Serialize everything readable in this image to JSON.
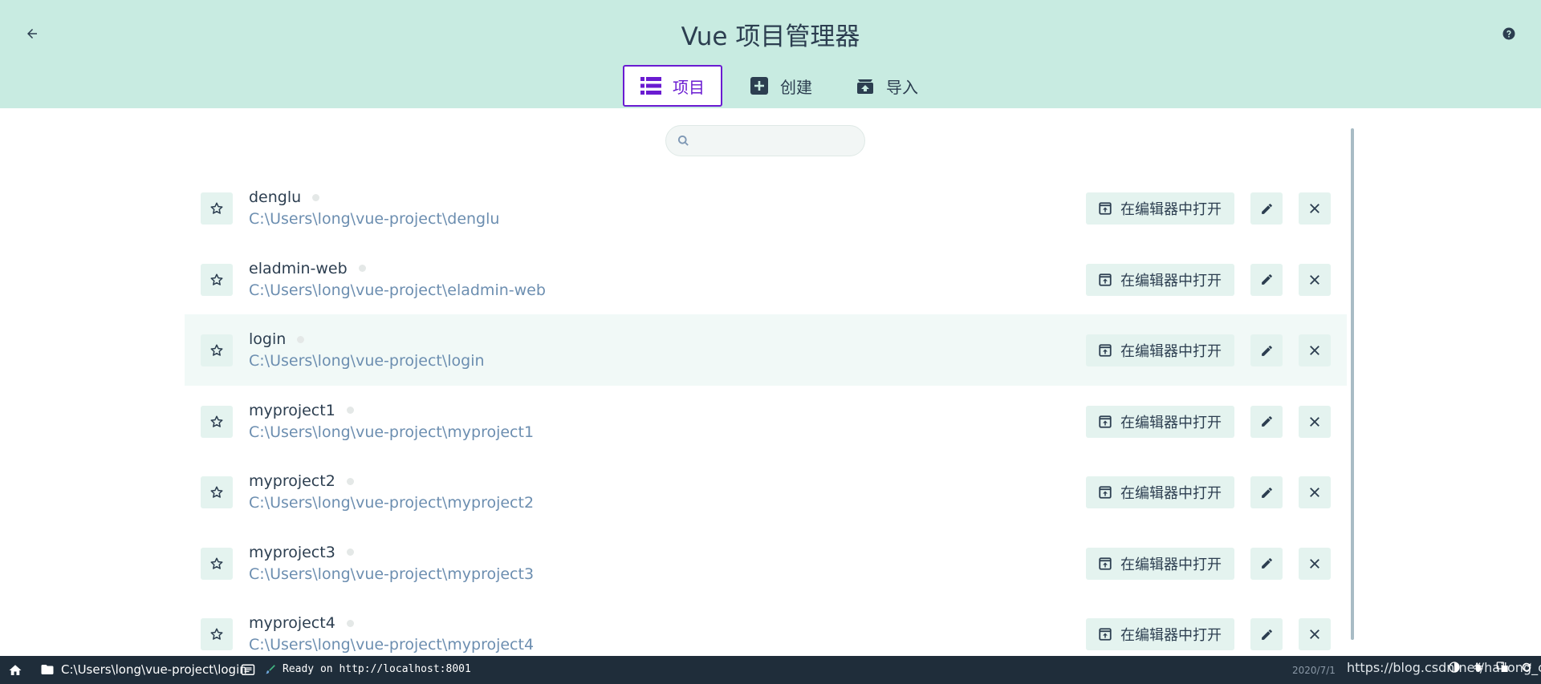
{
  "header": {
    "title": "Vue 项目管理器",
    "tabs": [
      {
        "label": "项目",
        "icon": "list-icon",
        "active": true
      },
      {
        "label": "创建",
        "icon": "add-box-icon",
        "active": false
      },
      {
        "label": "导入",
        "icon": "import-icon",
        "active": false
      }
    ]
  },
  "search": {
    "placeholder": "",
    "value": ""
  },
  "projects": [
    {
      "name": "denglu",
      "path": "C:\\Users\\long\\vue-project\\denglu"
    },
    {
      "name": "eladmin-web",
      "path": "C:\\Users\\long\\vue-project\\eladmin-web"
    },
    {
      "name": "login",
      "path": "C:\\Users\\long\\vue-project\\login",
      "selected": true
    },
    {
      "name": "myproject1",
      "path": "C:\\Users\\long\\vue-project\\myproject1"
    },
    {
      "name": "myproject2",
      "path": "C:\\Users\\long\\vue-project\\myproject2"
    },
    {
      "name": "myproject3",
      "path": "C:\\Users\\long\\vue-project\\myproject3"
    },
    {
      "name": "myproject4",
      "path": "C:\\Users\\long\\vue-project\\myproject4"
    }
  ],
  "row_actions": {
    "open_in_editor_label": "在编辑器中打开"
  },
  "statusbar": {
    "cwd": "C:\\Users\\long\\vue-project\\login",
    "ready": "Ready on http://localhost:8001",
    "date": "2020/7/1",
    "watermark_url": "https://blog.csdn.net/hailong_csdn"
  },
  "colors": {
    "header_bg": "#c8ebe1",
    "accent": "#6a1bd1",
    "button_bg": "#e4f3ef",
    "path_text": "#6c8eb0",
    "statusbar_bg": "#1f2d3a"
  }
}
